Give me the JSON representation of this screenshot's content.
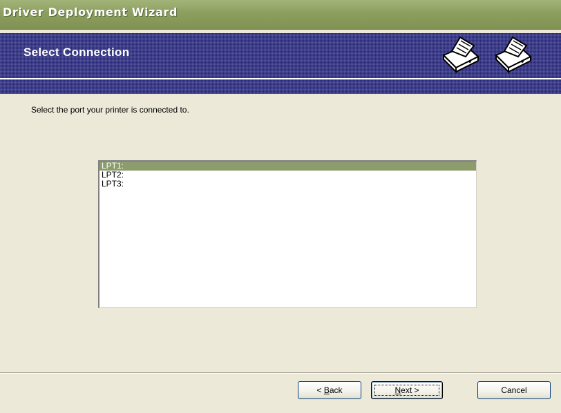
{
  "window": {
    "title": "Driver Deployment Wizard"
  },
  "banner": {
    "title": "Select Connection",
    "icons": [
      "printer-icon",
      "printer-icon"
    ]
  },
  "prompt": "Select the port your printer is connected to.",
  "ports": {
    "selected": "LPT1:",
    "items": [
      "LPT1:",
      "LPT2:",
      "LPT3:"
    ]
  },
  "buttons": {
    "back_prefix": "< ",
    "back_mnemonic": "B",
    "back_rest": "ack",
    "next_mnemonic": "N",
    "next_rest": "ext >",
    "cancel": "Cancel"
  },
  "colors": {
    "title_bar": "#8c9f5f",
    "banner": "#25257a",
    "selection": "#8c9c6c",
    "dialog_background": "#ece9d8"
  }
}
